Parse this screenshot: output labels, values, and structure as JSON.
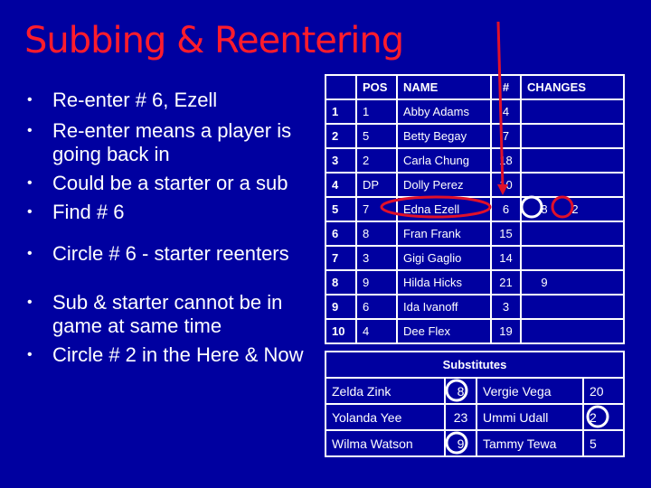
{
  "title": "Subbing & Reentering",
  "bullets": [
    {
      "text": "Re-enter # 6, Ezell"
    },
    {
      "text": "Re-enter means a player is"
    },
    {
      "text": "going back in",
      "continuation": true
    },
    {
      "text": "Could be a starter or a sub"
    },
    {
      "text": "Find # 6"
    },
    {
      "text": "Circle # 6 - starter reenters"
    },
    {
      "text": "Sub & starter cannot be in"
    },
    {
      "text": "game at same time",
      "continuation": true
    },
    {
      "text": "Circle # 2 in the Here & Now"
    }
  ],
  "lineup": {
    "headers": [
      "",
      "POS",
      "NAME",
      "#",
      "CHANGES"
    ],
    "rows": [
      {
        "order": "1",
        "pos": "1",
        "name": "Abby Adams",
        "num": "4",
        "changes": []
      },
      {
        "order": "2",
        "pos": "5",
        "name": "Betty Begay",
        "num": "7",
        "changes": []
      },
      {
        "order": "3",
        "pos": "2",
        "name": "Carla Chung",
        "num": "18",
        "changes": []
      },
      {
        "order": "4",
        "pos": "DP",
        "name": "Dolly Perez",
        "num": "10",
        "changes": []
      },
      {
        "order": "5",
        "pos": "7",
        "name": "Edna Ezell",
        "num": "6",
        "changes": [
          "8",
          "2"
        ]
      },
      {
        "order": "6",
        "pos": "8",
        "name": "Fran Frank",
        "num": "15",
        "changes": []
      },
      {
        "order": "7",
        "pos": "3",
        "name": "Gigi Gaglio",
        "num": "14",
        "changes": []
      },
      {
        "order": "8",
        "pos": "9",
        "name": "Hilda Hicks",
        "num": "21",
        "changes": [
          "9"
        ]
      },
      {
        "order": "9",
        "pos": "6",
        "name": "Ida Ivanoff",
        "num": "3",
        "changes": []
      },
      {
        "order": "10",
        "pos": "4",
        "name": "Dee Flex",
        "num": "19",
        "changes": []
      }
    ]
  },
  "substitutes": {
    "title": "Substitutes",
    "rows": [
      {
        "name1": "Zelda Zink",
        "num1": "8",
        "name2": "Vergie Vega",
        "num2": "20"
      },
      {
        "name1": "Yolanda Yee",
        "num1": "23",
        "name2": "Ummi Udall",
        "num2": "2"
      },
      {
        "name1": "Wilma Watson",
        "num1": "9",
        "name2": "Tammy Tewa",
        "num2": "5"
      }
    ]
  },
  "annotations": {
    "red": "#e0102a",
    "white": "#ffffff",
    "title_color": "#ff1c2c",
    "background": "#0000a0"
  }
}
